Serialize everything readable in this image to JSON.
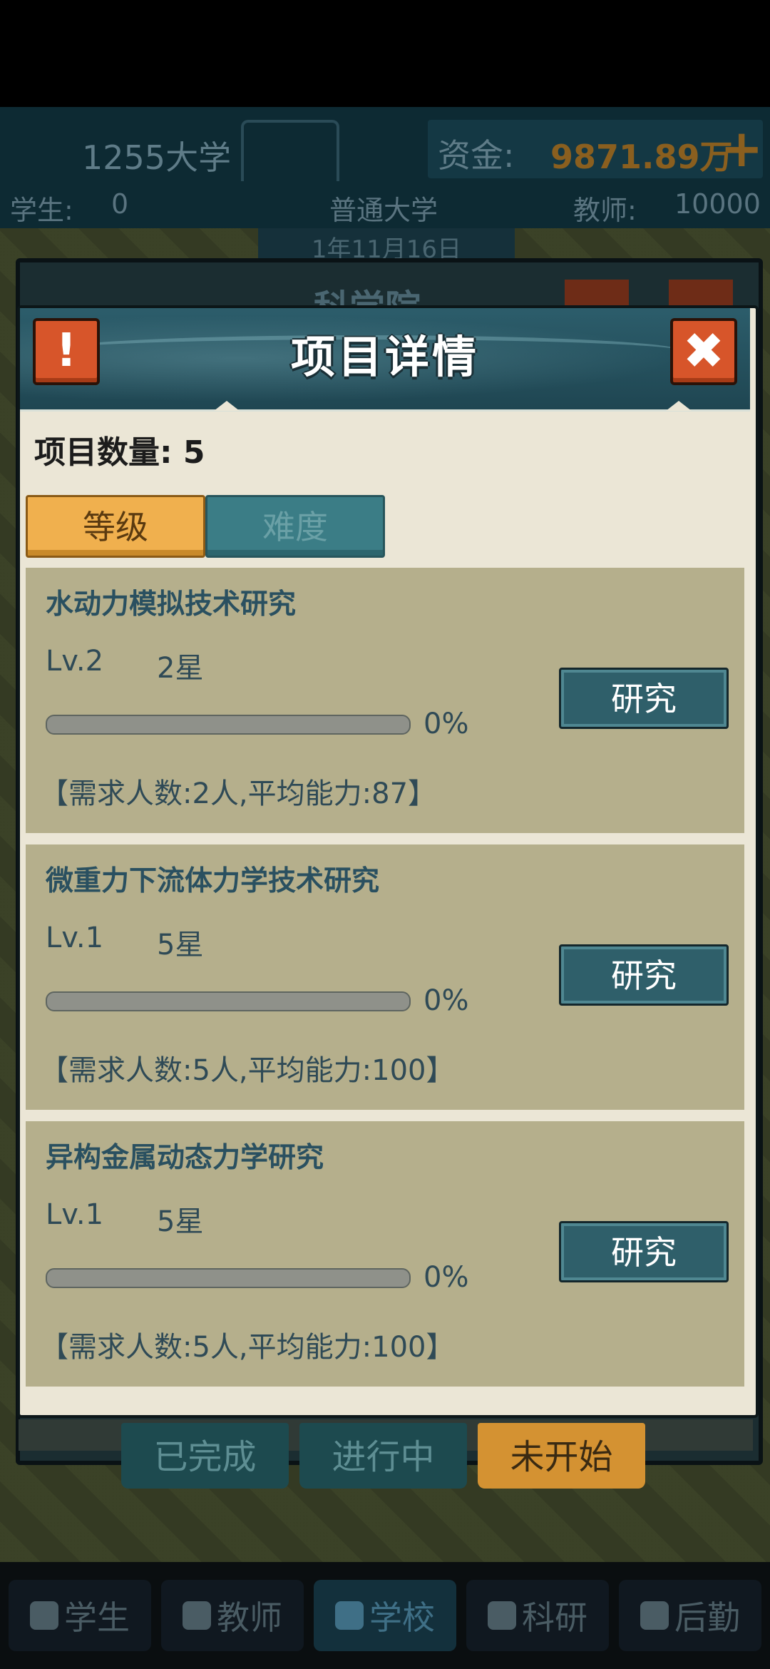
{
  "hud": {
    "school_name": "1255大学",
    "funds_label": "资金:",
    "funds_value": "9871.89万",
    "students_label": "学生:",
    "students_value": "0",
    "school_type": "普通大学",
    "teachers_label": "教师:",
    "teachers_value": "10000",
    "date": "1年11月16日",
    "plus_icon": "plus-icon"
  },
  "background_modal": {
    "title": "科学院"
  },
  "dialog": {
    "title": "项目详情",
    "alert_glyph": "!",
    "close_glyph": "✖",
    "count_label": "项目数量: 5",
    "filter_tabs": [
      {
        "label": "等级",
        "active": true
      },
      {
        "label": "难度",
        "active": false
      }
    ],
    "items": [
      {
        "title": "水动力模拟技术研究",
        "level": "Lv.2",
        "stars": "2星",
        "progress": 0,
        "progress_text": "0%",
        "requirement": "【需求人数:2人,平均能力:87】",
        "button": "研究"
      },
      {
        "title": "微重力下流体力学技术研究",
        "level": "Lv.1",
        "stars": "5星",
        "progress": 0,
        "progress_text": "0%",
        "requirement": "【需求人数:5人,平均能力:100】",
        "button": "研究"
      },
      {
        "title": "异构金属动态力学研究",
        "level": "Lv.1",
        "stars": "5星",
        "progress": 0,
        "progress_text": "0%",
        "requirement": "【需求人数:5人,平均能力:100】",
        "button": "研究"
      }
    ]
  },
  "status_tabs": [
    {
      "label": "已完成",
      "active": false
    },
    {
      "label": "进行中",
      "active": false
    },
    {
      "label": "未开始",
      "active": true
    }
  ],
  "bottom_nav": [
    {
      "label": "学生",
      "icon": "student-icon",
      "active": false
    },
    {
      "label": "教师",
      "icon": "teacher-icon",
      "active": false
    },
    {
      "label": "学校",
      "icon": "school-icon",
      "active": true
    },
    {
      "label": "科研",
      "icon": "flask-icon",
      "active": false
    },
    {
      "label": "后勤",
      "icon": "clipboard-icon",
      "active": false
    }
  ]
}
